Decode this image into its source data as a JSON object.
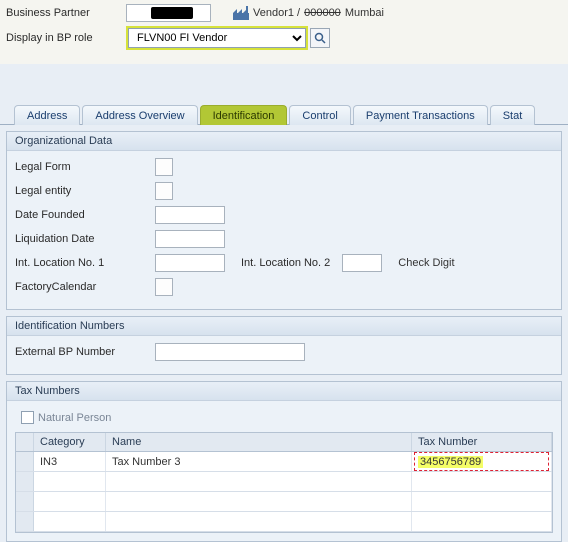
{
  "header": {
    "bp_label": "Business Partner",
    "bp_value": "",
    "vendor_prefix": "Vendor1 /",
    "vendor_code": "000000",
    "vendor_city": "Mumbai",
    "role_label": "Display in BP role",
    "role_value": "FLVN00 FI Vendor"
  },
  "tabs": {
    "address": "Address",
    "overview": "Address Overview",
    "identification": "Identification",
    "control": "Control",
    "payment": "Payment Transactions",
    "status": "Stat"
  },
  "org": {
    "title": "Organizational Data",
    "legal_form": "Legal Form",
    "legal_entity": "Legal entity",
    "date_founded": "Date Founded",
    "liquidation": "Liquidation Date",
    "loc1": "Int. Location No. 1",
    "loc2": "Int. Location No. 2",
    "check_digit": "Check Digit",
    "factory_cal": "FactoryCalendar"
  },
  "ident": {
    "title": "Identification Numbers",
    "ext_bp": "External BP Number"
  },
  "tax": {
    "title": "Tax Numbers",
    "natural_person": "Natural Person",
    "col_category": "Category",
    "col_name": "Name",
    "col_taxnum": "Tax Number",
    "rows": [
      {
        "category": "IN3",
        "name": "Tax Number 3",
        "taxnum": "3456756789"
      }
    ]
  }
}
